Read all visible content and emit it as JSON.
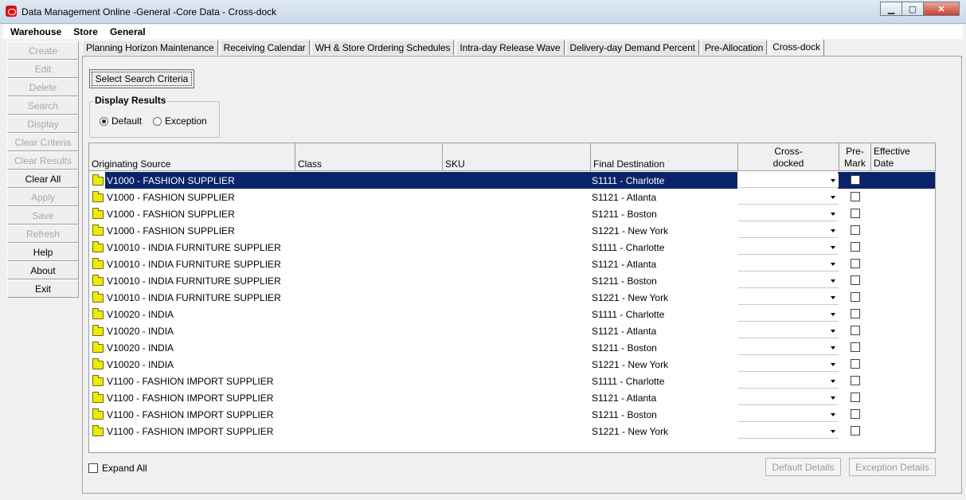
{
  "window": {
    "title": "Data Management Online -General -Core Data - Cross-dock"
  },
  "menu": [
    "Warehouse",
    "Store",
    "General"
  ],
  "left_buttons": [
    {
      "label": "Create",
      "enabled": false
    },
    {
      "label": "Edit",
      "enabled": false
    },
    {
      "label": "Delete",
      "enabled": false
    },
    {
      "label": "Search",
      "enabled": false
    },
    {
      "label": "Display",
      "enabled": false
    },
    {
      "label": "Clear Criteria",
      "enabled": false
    },
    {
      "label": "Clear Results",
      "enabled": false
    },
    {
      "label": "Clear All",
      "enabled": true
    },
    {
      "label": "Apply",
      "enabled": false
    },
    {
      "label": "Save",
      "enabled": false
    },
    {
      "label": "Refresh",
      "enabled": false
    },
    {
      "label": "Help",
      "enabled": true
    },
    {
      "label": "About",
      "enabled": true
    },
    {
      "label": "Exit",
      "enabled": true
    }
  ],
  "tabs": [
    {
      "label": "Planning Horizon Maintenance",
      "active": false
    },
    {
      "label": "Receiving Calendar",
      "active": false
    },
    {
      "label": "WH & Store Ordering Schedules",
      "active": false
    },
    {
      "label": "Intra-day Release Wave",
      "active": false
    },
    {
      "label": "Delivery-day Demand Percent",
      "active": false
    },
    {
      "label": "Pre-Allocation",
      "active": false
    },
    {
      "label": "Cross-dock",
      "active": true
    }
  ],
  "select_search_label": "Select Search Criteria",
  "display_results": {
    "legend": "Display Results",
    "options": [
      "Default",
      "Exception"
    ],
    "selected": "Default"
  },
  "table": {
    "headers": {
      "source": "Originating Source",
      "class": "Class",
      "sku": "SKU",
      "dest": "Final Destination",
      "crossdocked_1": "Cross-",
      "crossdocked_2": "docked",
      "premark_1": "Pre-",
      "premark_2": "Mark",
      "effective_1": "Effective",
      "effective_2": "Date"
    },
    "selected_row": 0,
    "rows": [
      {
        "source": "V1000 - FASHION SUPPLIER",
        "dest": "S1111 - Charlotte"
      },
      {
        "source": "V1000 - FASHION SUPPLIER",
        "dest": "S1121 - Atlanta"
      },
      {
        "source": "V1000 - FASHION SUPPLIER",
        "dest": "S1211 - Boston"
      },
      {
        "source": "V1000 - FASHION SUPPLIER",
        "dest": "S1221 - New York"
      },
      {
        "source": "V10010 - INDIA FURNITURE SUPPLIER",
        "dest": "S1111 - Charlotte"
      },
      {
        "source": "V10010 - INDIA FURNITURE SUPPLIER",
        "dest": "S1121 - Atlanta"
      },
      {
        "source": "V10010 - INDIA FURNITURE SUPPLIER",
        "dest": "S1211 - Boston"
      },
      {
        "source": "V10010 - INDIA FURNITURE SUPPLIER",
        "dest": "S1221 - New York"
      },
      {
        "source": "V10020 - INDIA",
        "dest": "S1111 - Charlotte"
      },
      {
        "source": "V10020 - INDIA",
        "dest": "S1121 - Atlanta"
      },
      {
        "source": "V10020 - INDIA",
        "dest": "S1211 - Boston"
      },
      {
        "source": "V10020 - INDIA",
        "dest": "S1221 - New York"
      },
      {
        "source": "V1100 - FASHION IMPORT SUPPLIER",
        "dest": "S1111 - Charlotte"
      },
      {
        "source": "V1100 - FASHION IMPORT SUPPLIER",
        "dest": "S1121 - Atlanta"
      },
      {
        "source": "V1100 - FASHION IMPORT SUPPLIER",
        "dest": "S1211 - Boston"
      },
      {
        "source": "V1100 - FASHION IMPORT SUPPLIER",
        "dest": "S1221 - New York"
      }
    ]
  },
  "expand_all_label": "Expand All",
  "default_details_label": "Default Details",
  "exception_details_label": "Exception Details",
  "colors": {
    "selection": "#0a246a",
    "folder": "#ecec00",
    "disabled_text": "#a8a8a8"
  }
}
